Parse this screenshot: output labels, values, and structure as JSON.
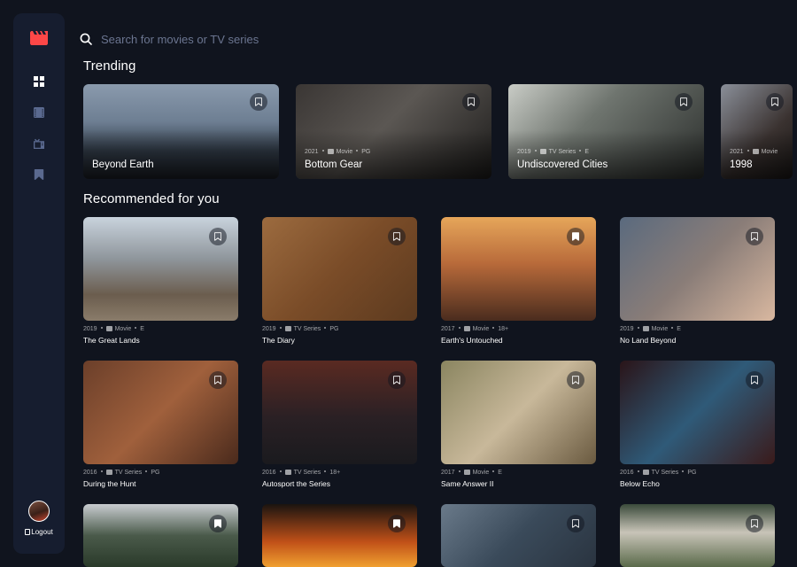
{
  "colors": {
    "background": "#10141e",
    "sidebar": "#161d2f",
    "accent": "#fc4747",
    "nav_icon": "#5a698f",
    "placeholder": "#6b7590"
  },
  "sidebar": {
    "logo_icon": "clapperboard-icon",
    "items": [
      {
        "name": "home",
        "icon": "grid-icon",
        "active": true
      },
      {
        "name": "movies",
        "icon": "film-icon",
        "active": false
      },
      {
        "name": "tv-series",
        "icon": "tv-icon",
        "active": false
      },
      {
        "name": "bookmarks",
        "icon": "bookmark-icon",
        "active": false
      }
    ],
    "logout_label": "Logout"
  },
  "search": {
    "placeholder": "Search for movies or TV series",
    "value": ""
  },
  "trending": {
    "heading": "Trending",
    "items": [
      {
        "title": "Beyond Earth",
        "year": "",
        "category": "",
        "rating": "",
        "bookmarked": false
      },
      {
        "title": "Bottom Gear",
        "year": "2021",
        "category": "Movie",
        "rating": "PG",
        "bookmarked": false
      },
      {
        "title": "Undiscovered Cities",
        "year": "2019",
        "category": "TV Series",
        "rating": "E",
        "bookmarked": false
      },
      {
        "title": "1998",
        "year": "2021",
        "category": "Movie",
        "rating": "",
        "bookmarked": false
      }
    ]
  },
  "recommended": {
    "heading": "Recommended for you",
    "items": [
      {
        "title": "The Great Lands",
        "year": "2019",
        "category": "Movie",
        "rating": "E",
        "bookmarked": false
      },
      {
        "title": "The Diary",
        "year": "2019",
        "category": "TV Series",
        "rating": "PG",
        "bookmarked": false
      },
      {
        "title": "Earth's Untouched",
        "year": "2017",
        "category": "Movie",
        "rating": "18+",
        "bookmarked": true
      },
      {
        "title": "No Land Beyond",
        "year": "2019",
        "category": "Movie",
        "rating": "E",
        "bookmarked": false
      },
      {
        "title": "During the Hunt",
        "year": "2016",
        "category": "TV Series",
        "rating": "PG",
        "bookmarked": false
      },
      {
        "title": "Autosport the Series",
        "year": "2016",
        "category": "TV Series",
        "rating": "18+",
        "bookmarked": false
      },
      {
        "title": "Same Answer II",
        "year": "2017",
        "category": "Movie",
        "rating": "E",
        "bookmarked": false
      },
      {
        "title": "Below Echo",
        "year": "2016",
        "category": "TV Series",
        "rating": "PG",
        "bookmarked": false
      },
      {
        "title": "",
        "year": "",
        "category": "",
        "rating": "",
        "bookmarked": true
      },
      {
        "title": "",
        "year": "",
        "category": "",
        "rating": "",
        "bookmarked": true
      },
      {
        "title": "",
        "year": "",
        "category": "",
        "rating": "",
        "bookmarked": false
      },
      {
        "title": "",
        "year": "",
        "category": "",
        "rating": "",
        "bookmarked": false
      }
    ]
  }
}
